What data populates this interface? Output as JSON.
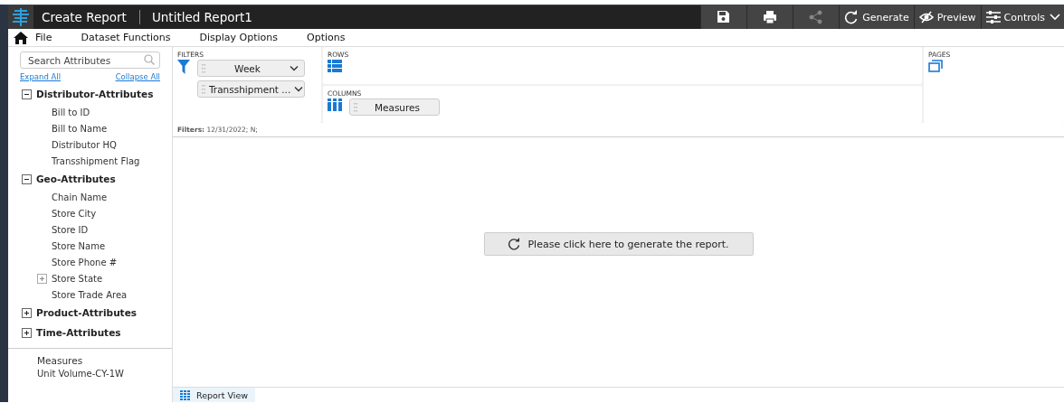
{
  "app_title": "Create Report",
  "report_title": "Untitled Report1",
  "toolbar": [
    {
      "kind": "save"
    },
    {
      "kind": "print"
    },
    {
      "kind": "share",
      "disabled": true
    },
    {
      "kind": "generate",
      "label": "Generate"
    },
    {
      "kind": "preview",
      "label": "Preview"
    },
    {
      "kind": "controls",
      "label": "Controls"
    }
  ],
  "menu": [
    "File",
    "Dataset Functions",
    "Display Options",
    "Options"
  ],
  "sidebar": {
    "search": {
      "placeholder": "Search Attributes"
    },
    "expand_all": "Expand All",
    "collapse_all": "Collapse All",
    "tree": [
      {
        "label": "Distributor-Attributes",
        "kind": "group",
        "expanded": true,
        "children": [
          {
            "label": "Bill to ID",
            "kind": "leaf"
          },
          {
            "label": "Bill to Name",
            "kind": "leaf"
          },
          {
            "label": "Distributor HQ",
            "kind": "leaf"
          },
          {
            "label": "Transshipment Flag",
            "kind": "leaf"
          }
        ]
      },
      {
        "label": "Geo-Attributes",
        "kind": "group",
        "expanded": true,
        "children": [
          {
            "label": "Chain Name",
            "kind": "leaf"
          },
          {
            "label": "Store City",
            "kind": "leaf"
          },
          {
            "label": "Store ID",
            "kind": "leaf"
          },
          {
            "label": "Store Name",
            "kind": "leaf"
          },
          {
            "label": "Store Phone #",
            "kind": "leaf"
          },
          {
            "label": "Store State",
            "kind": "group",
            "expanded": false
          },
          {
            "label": "Store Trade Area",
            "kind": "leaf"
          }
        ]
      },
      {
        "label": "Product-Attributes",
        "kind": "group",
        "expanded": false
      },
      {
        "label": "Time-Attributes",
        "kind": "group",
        "expanded": false
      }
    ],
    "measures_heading": "Measures",
    "measures": [
      "Unit Volume-CY-1W"
    ]
  },
  "filters": {
    "label": "FILTERS",
    "items": [
      "Week",
      "Transshipment ..."
    ]
  },
  "rows": {
    "label": "ROWS"
  },
  "columns": {
    "label": "COLUMNS",
    "items": [
      "Measures"
    ]
  },
  "pages": {
    "label": "PAGES"
  },
  "filter_summary": {
    "label": "Filters:",
    "value": "12/31/2022; N;"
  },
  "generate_prompt": "Please click here to generate the report.",
  "bottom_tabs": [
    {
      "label": "Report View",
      "selected": true
    }
  ]
}
